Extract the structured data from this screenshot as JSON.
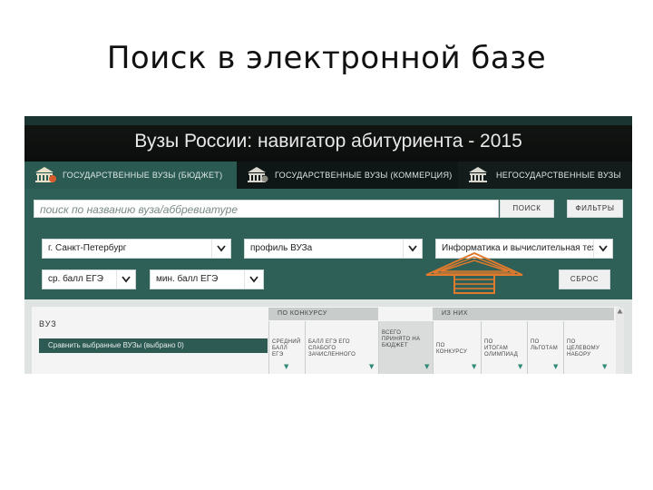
{
  "slide_title": "Поиск в электронной базе",
  "app": {
    "title": "Вузы России: навигатор абитуриента - 2015",
    "tabs": [
      {
        "label": "ГОСУДАРСТВЕННЫЕ ВУЗЫ (БЮДЖЕТ)",
        "active": true
      },
      {
        "label": "ГОСУДАРСТВЕННЫЕ ВУЗЫ (КОММЕРЦИЯ)",
        "active": false
      },
      {
        "label": "НЕГОСУДАРСТВЕННЫЕ ВУЗЫ",
        "active": false
      }
    ],
    "search": {
      "placeholder": "поиск по названию вуза/аббревиатуре",
      "search_button": "ПОИСК",
      "filters_button": "ФИЛЬТРЫ"
    },
    "filters": {
      "city": "г. Санкт-Петербург",
      "profile": "профиль ВУЗа",
      "subject": "Информатика и вычислительная техника",
      "avg_score": "ср. балл ЕГЭ",
      "min_score": "мин. балл ЕГЭ",
      "reset_button": "СБРОС"
    },
    "table": {
      "vuz_label": "ВУЗ",
      "compare_button": "Сравнить выбранные ВУЗы (выбрано 0)",
      "group_competition": "ПО КОНКУРСУ",
      "group_of_them": "ИЗ НИХ",
      "columns": [
        "СРЕДНИЙ\nБАЛЛ\nЕГЭ",
        "БАЛЛ ЕГЭ ЕГО\nСЛАБОГО\nЗАЧИСЛЕННОГО",
        "ВСЕГО\nПРИНЯТО НА\nБЮДЖЕТ",
        "ПО\nКОНКУРСУ",
        "ПО\nИТОГАМ\nОЛИМПИАД",
        "ПО\nЛЬГОТАМ",
        "ПО\nЦЕЛЕВОМУ\nНАБОРУ"
      ]
    }
  },
  "colors": {
    "panel": "#2f6058",
    "active_tab": "#2b5a53",
    "header": "#0c0e0d",
    "arrow": "#e07a2c"
  }
}
